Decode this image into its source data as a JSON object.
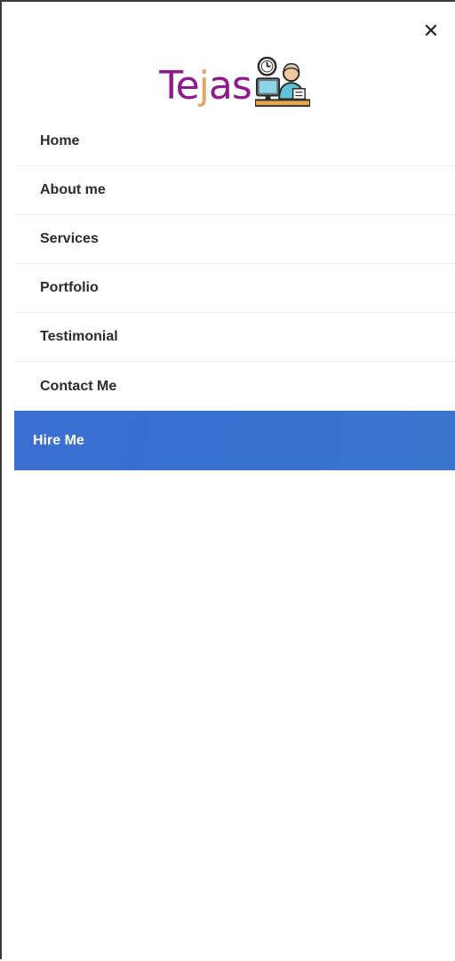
{
  "drawer": {
    "close_glyph": "✕",
    "logo": {
      "text_part1": "Te",
      "text_part2": "j",
      "text_part3": "as",
      "icon": "person-at-desk-with-clock-icon"
    },
    "menu": [
      {
        "label": "Home"
      },
      {
        "label": "About me"
      },
      {
        "label": "Services"
      },
      {
        "label": "Portfolio"
      },
      {
        "label": "Testimonial"
      },
      {
        "label": "Contact Me"
      }
    ],
    "hire_button_label": "Hire Me"
  },
  "colors": {
    "brand_purple": "#8e1b8e",
    "brand_gold": "#e0a765",
    "accent_blue": "#3772cf",
    "text": "#2b2b2b"
  }
}
